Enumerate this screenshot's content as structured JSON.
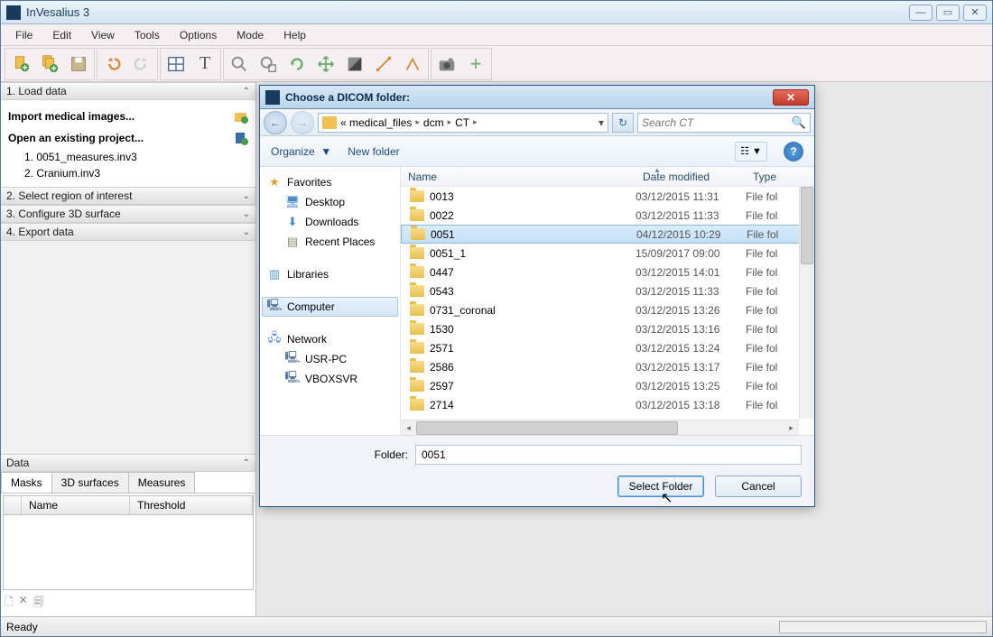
{
  "app": {
    "title": "InVesalius 3"
  },
  "menus": [
    "File",
    "Edit",
    "View",
    "Tools",
    "Options",
    "Mode",
    "Help"
  ],
  "left": {
    "section1": "1. Load data",
    "import_label": "Import medical images...",
    "open_label": "Open an existing project...",
    "recent": [
      "1. 0051_measures.inv3",
      "2. Cranium.inv3"
    ],
    "section2": "2. Select region of interest",
    "section3": "3. Configure 3D surface",
    "section4": "4. Export data",
    "data_header": "Data",
    "tabs": [
      "Masks",
      "3D surfaces",
      "Measures"
    ],
    "grid_cols": [
      "Name",
      "Threshold"
    ]
  },
  "status": {
    "text": "Ready"
  },
  "dialog": {
    "title": "Choose a DICOM folder:",
    "breadcrumb": [
      "«  medical_files",
      "dcm",
      "CT"
    ],
    "search_placeholder": "Search CT",
    "organize": "Organize",
    "new_folder": "New folder",
    "tree": {
      "favorites": "Favorites",
      "fav_items": [
        "Desktop",
        "Downloads",
        "Recent Places"
      ],
      "libraries": "Libraries",
      "computer": "Computer",
      "network": "Network",
      "net_items": [
        "USR-PC",
        "VBOXSVR"
      ]
    },
    "cols": {
      "name": "Name",
      "date": "Date modified",
      "type": "Type"
    },
    "rows": [
      {
        "name": "0013",
        "date": "03/12/2015 11:31",
        "type": "File fol"
      },
      {
        "name": "0022",
        "date": "03/12/2015 11:33",
        "type": "File fol"
      },
      {
        "name": "0051",
        "date": "04/12/2015 10:29",
        "type": "File fol",
        "selected": true
      },
      {
        "name": "0051_1",
        "date": "15/09/2017 09:00",
        "type": "File fol"
      },
      {
        "name": "0447",
        "date": "03/12/2015 14:01",
        "type": "File fol"
      },
      {
        "name": "0543",
        "date": "03/12/2015 11:33",
        "type": "File fol"
      },
      {
        "name": "0731_coronal",
        "date": "03/12/2015 13:26",
        "type": "File fol"
      },
      {
        "name": "1530",
        "date": "03/12/2015 13:16",
        "type": "File fol"
      },
      {
        "name": "2571",
        "date": "03/12/2015 13:24",
        "type": "File fol"
      },
      {
        "name": "2586",
        "date": "03/12/2015 13:17",
        "type": "File fol"
      },
      {
        "name": "2597",
        "date": "03/12/2015 13:25",
        "type": "File fol"
      },
      {
        "name": "2714",
        "date": "03/12/2015 13:18",
        "type": "File fol"
      }
    ],
    "folder_label": "Folder:",
    "folder_value": "0051",
    "select_btn": "Select Folder",
    "cancel_btn": "Cancel"
  }
}
